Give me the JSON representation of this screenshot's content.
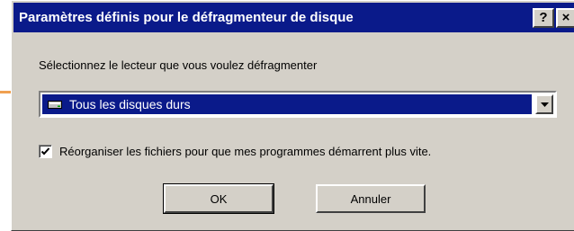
{
  "dialog": {
    "title": "Paramètres définis pour le défragmenteur de disque",
    "help_button": "?",
    "close_button": "×",
    "instruction": "Sélectionnez le lecteur que vous voulez défragmenter",
    "drive_select": {
      "selected_value": "Tous les disques durs",
      "icon": "hard-drive-icon"
    },
    "reorganize_checkbox": {
      "checked": true,
      "label": "Réorganiser les fichiers pour que mes programmes démarrent plus vite."
    },
    "ok_label": "OK",
    "cancel_label": "Annuler"
  },
  "colors": {
    "titlebar": "#0a1a8a",
    "face": "#d4d0c8",
    "pointer": "#f0a050"
  }
}
